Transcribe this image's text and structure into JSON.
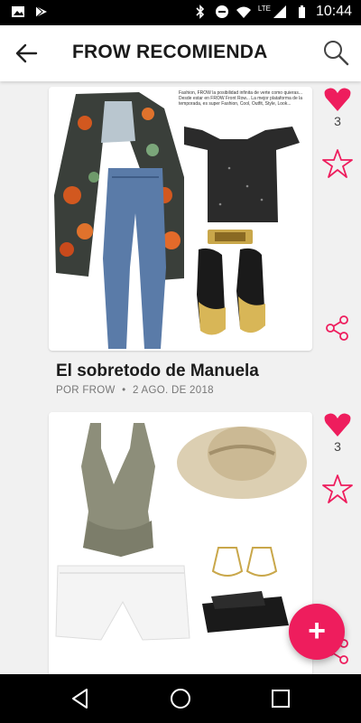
{
  "status_bar": {
    "time": "10:44",
    "network": "LTE"
  },
  "header": {
    "title": "FROW RECOMIENDA"
  },
  "posts": [
    {
      "title": "El sobretodo de Manuela",
      "author": "POR FROW",
      "separator": "•",
      "date": "2 AGO. DE 2018",
      "likes": "3",
      "caption": "Fashion, FROW la posibilidad infinita de verte como quieras... Desde estar en FROW Front Row... La mejor plataforma de la temporada, es super Fashion, Cool, Outfit, Style, Look..."
    },
    {
      "likes": "3"
    }
  ],
  "fab": {
    "label": "+"
  },
  "colors": {
    "accent": "#ee1d5d",
    "appbar": "#ffffff",
    "background": "#f1f1f1"
  },
  "icons": [
    "image-icon",
    "play-store-icon",
    "bluetooth-icon",
    "dnd-icon",
    "wifi-icon",
    "signal-icon",
    "battery-icon",
    "back-arrow-icon",
    "search-icon",
    "heart-icon",
    "star-icon",
    "share-icon",
    "plus-icon",
    "nav-back-icon",
    "nav-home-icon",
    "nav-recents-icon"
  ]
}
